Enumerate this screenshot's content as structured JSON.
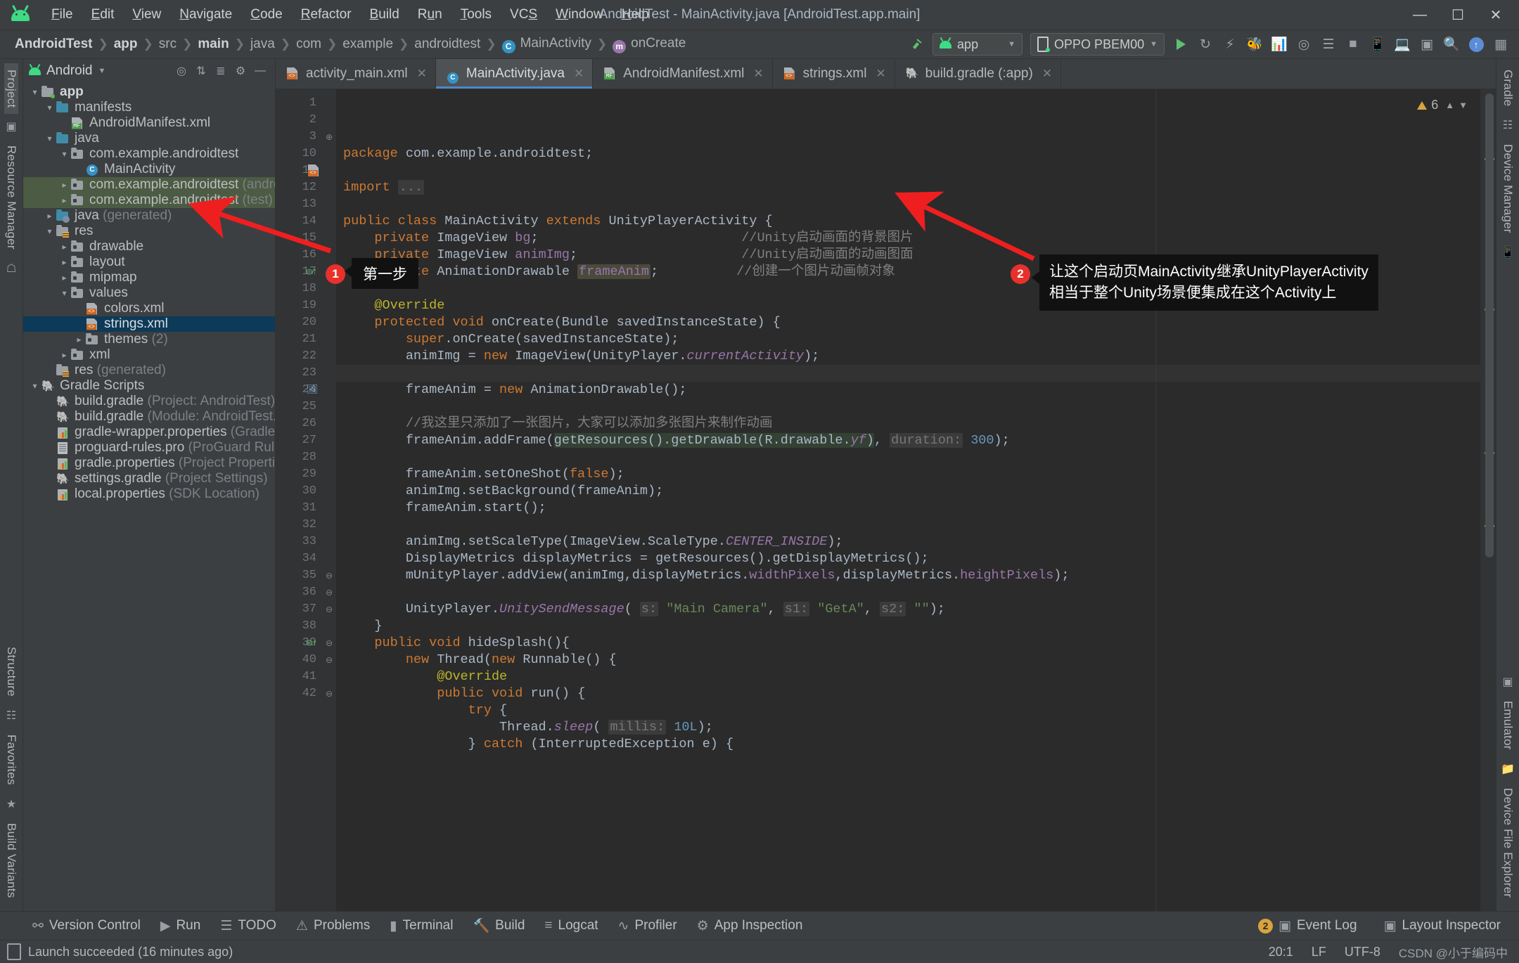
{
  "window": {
    "title": "AndroidTest - MainActivity.java [AndroidTest.app.main]",
    "minimize": "—",
    "maximize": "▢",
    "close": "✕"
  },
  "menu": [
    "File",
    "Edit",
    "View",
    "Navigate",
    "Code",
    "Refactor",
    "Build",
    "Run",
    "Tools",
    "VCS",
    "Window",
    "Help"
  ],
  "breadcrumb": [
    {
      "label": "AndroidTest",
      "bold": true
    },
    {
      "label": "app",
      "bold": true
    },
    {
      "label": "src",
      "bold": false
    },
    {
      "label": "main",
      "bold": true
    },
    {
      "label": "java",
      "bold": false
    },
    {
      "label": "com",
      "bold": false
    },
    {
      "label": "example",
      "bold": false
    },
    {
      "label": "androidtest",
      "bold": false
    },
    {
      "label": "MainActivity",
      "bold": false,
      "icon": "class-icon",
      "icon_letter": "C"
    },
    {
      "label": "onCreate",
      "bold": false,
      "icon": "method-icon",
      "icon_letter": "m"
    }
  ],
  "toolbar": {
    "module_selector": "app",
    "device_selector": "OPPO PBEM00",
    "run_label": "Run",
    "icons": [
      "build-icon",
      "run-icon",
      "rerun-icon",
      "debug-icon",
      "profile-icon",
      "attach-debugger-icon",
      "sdk-manager-icon",
      "avd-manager-icon",
      "stop-icon",
      "search-everywhere-icon",
      "project-structure-icon",
      "notifications-icon",
      "layout-inspector-icon",
      "device-file-explorer-icon"
    ]
  },
  "project_panel": {
    "title": "Android",
    "actions": [
      "locate-icon",
      "expand-all-icon",
      "collapse-all-icon",
      "settings-icon",
      "hide-icon"
    ],
    "tree": [
      {
        "depth": 0,
        "arrow": "v",
        "icon": "folder-module",
        "label": "app",
        "bold": true,
        "suffix": ""
      },
      {
        "depth": 1,
        "arrow": "v",
        "icon": "folder-blue",
        "label": "manifests",
        "suffix": ""
      },
      {
        "depth": 2,
        "arrow": "",
        "icon": "xml-manifest",
        "label": "AndroidManifest.xml",
        "suffix": ""
      },
      {
        "depth": 1,
        "arrow": "v",
        "icon": "folder-blue",
        "label": "java",
        "suffix": ""
      },
      {
        "depth": 2,
        "arrow": "v",
        "icon": "folder-package",
        "label": "com.example.androidtest",
        "suffix": ""
      },
      {
        "depth": 3,
        "arrow": "",
        "icon": "class-icon",
        "label": "MainActivity",
        "suffix": ""
      },
      {
        "depth": 2,
        "arrow": ">",
        "icon": "folder-package",
        "label": "com.example.androidtest",
        "suffix": " (androidTest)",
        "green": true
      },
      {
        "depth": 2,
        "arrow": ">",
        "icon": "folder-package",
        "label": "com.example.androidtest",
        "suffix": " (test)",
        "green": true
      },
      {
        "depth": 1,
        "arrow": ">",
        "icon": "folder-generated",
        "label": "java",
        "suffix": " (generated)"
      },
      {
        "depth": 1,
        "arrow": "v",
        "icon": "folder-res",
        "label": "res",
        "suffix": ""
      },
      {
        "depth": 2,
        "arrow": ">",
        "icon": "folder-package",
        "label": "drawable",
        "suffix": ""
      },
      {
        "depth": 2,
        "arrow": ">",
        "icon": "folder-package",
        "label": "layout",
        "suffix": ""
      },
      {
        "depth": 2,
        "arrow": ">",
        "icon": "folder-package",
        "label": "mipmap",
        "suffix": ""
      },
      {
        "depth": 2,
        "arrow": "v",
        "icon": "folder-package",
        "label": "values",
        "suffix": ""
      },
      {
        "depth": 3,
        "arrow": "",
        "icon": "xml-file",
        "label": "colors.xml",
        "suffix": ""
      },
      {
        "depth": 3,
        "arrow": "",
        "icon": "xml-file",
        "label": "strings.xml",
        "suffix": "",
        "selected": true
      },
      {
        "depth": 3,
        "arrow": ">",
        "icon": "folder-package",
        "label": "themes",
        "suffix": " (2)"
      },
      {
        "depth": 2,
        "arrow": ">",
        "icon": "folder-package",
        "label": "xml",
        "suffix": ""
      },
      {
        "depth": 1,
        "arrow": "",
        "icon": "folder-res",
        "label": "res",
        "suffix": " (generated)"
      },
      {
        "depth": 0,
        "arrow": "v",
        "icon": "gradle-icon",
        "label": "Gradle Scripts",
        "suffix": ""
      },
      {
        "depth": 1,
        "arrow": "",
        "icon": "gradle-icon",
        "label": "build.gradle",
        "suffix": " (Project: AndroidTest)"
      },
      {
        "depth": 1,
        "arrow": "",
        "icon": "gradle-icon",
        "label": "build.gradle",
        "suffix": " (Module: AndroidTest.app)"
      },
      {
        "depth": 1,
        "arrow": "",
        "icon": "properties-icon",
        "label": "gradle-wrapper.properties",
        "suffix": " (Gradle Version)"
      },
      {
        "depth": 1,
        "arrow": "",
        "icon": "doc-icon",
        "label": "proguard-rules.pro",
        "suffix": " (ProGuard Rules for Android"
      },
      {
        "depth": 1,
        "arrow": "",
        "icon": "properties-icon",
        "label": "gradle.properties",
        "suffix": " (Project Properties)"
      },
      {
        "depth": 1,
        "arrow": "",
        "icon": "gradle-icon",
        "label": "settings.gradle",
        "suffix": " (Project Settings)"
      },
      {
        "depth": 1,
        "arrow": "",
        "icon": "properties-icon",
        "label": "local.properties",
        "suffix": " (SDK Location)"
      }
    ]
  },
  "left_rail": [
    "Project",
    "Resource Manager",
    "Favorites",
    "Structure",
    "Build Variants"
  ],
  "right_rail": [
    "Gradle",
    "Device Manager",
    "Emulator",
    "Device File Explorer"
  ],
  "editor_tabs": [
    {
      "label": "activity_main.xml",
      "icon": "xml-file-icon",
      "active": false,
      "closable": true
    },
    {
      "label": "MainActivity.java",
      "icon": "class-icon",
      "active": true,
      "closable": true
    },
    {
      "label": "AndroidManifest.xml",
      "icon": "manifest-icon",
      "active": false,
      "closable": true
    },
    {
      "label": "strings.xml",
      "icon": "xml-file-icon",
      "active": false,
      "closable": true
    },
    {
      "label": "build.gradle (:app)",
      "icon": "gradle-icon",
      "active": false,
      "closable": true
    }
  ],
  "inspection": {
    "warning_count": "6"
  },
  "code": {
    "lines": [
      {
        "n": "1",
        "html": "<span class='kw'>package</span> com.example.androidtest;"
      },
      {
        "n": "2",
        "html": ""
      },
      {
        "n": "3",
        "html": "<span class='kw'>import</span> <span class='hint'>...</span>",
        "fold": "+"
      },
      {
        "n": "10",
        "html": ""
      },
      {
        "n": "11",
        "html": "<span class='kw'>public class</span> MainActivity <span class='kw'>extends</span> UnityPlayerActivity {",
        "gmark": "xml-file-icon"
      },
      {
        "n": "12",
        "html": "    <span class='kw'>private</span> ImageView <span class='fld'>bg</span>;                          <span class='cm'>//Unity启动画面的背景图片</span>"
      },
      {
        "n": "13",
        "html": "    <span class='kw'>private</span> ImageView <span class='fld'>animImg</span>;                     <span class='cm'>//Unity启动画面的动画图面</span>"
      },
      {
        "n": "14",
        "html": "    <span class='kw'>private</span> AnimationDrawable <span class='marker fld'>frameAnim</span>;          <span class='cm'>//创建一个图片动画帧对象</span>"
      },
      {
        "n": "15",
        "html": ""
      },
      {
        "n": "16",
        "html": "    <span class='anno'>@Override</span>"
      },
      {
        "n": "17",
        "html": "    <span class='kw'>protected void</span> onCreate(Bundle savedInstanceState) {",
        "gmark": "override-icon",
        "fold": "-"
      },
      {
        "n": "18",
        "html": "        <span class='kw'>super</span>.onCreate(savedInstanceState);"
      },
      {
        "n": "19",
        "html": "        animImg = <span class='kw'>new</span> ImageView(UnityPlayer.<span class='st'>currentActivity</span>);"
      },
      {
        "n": "20",
        "html": "",
        "current": true
      },
      {
        "n": "21",
        "html": "        frameAnim = <span class='kw'>new</span> AnimationDrawable();"
      },
      {
        "n": "22",
        "html": ""
      },
      {
        "n": "23",
        "html": "        <span class='cm'>//我这里只添加了一张图片，大家可以添加多张图片来制作动画</span>"
      },
      {
        "n": "24",
        "html": "        frameAnim.addFrame(<span class='fnhl'>getResources().getDrawable(R.drawable.<span class='st'>yf</span>)</span>, <span class='hint'>duration:</span> <span class='num'>300</span>);",
        "gmark": "image-icon"
      },
      {
        "n": "25",
        "html": ""
      },
      {
        "n": "26",
        "html": "        frameAnim.setOneShot(<span class='kw'>false</span>);"
      },
      {
        "n": "27",
        "html": "        animImg.setBackground(frameAnim);"
      },
      {
        "n": "28",
        "html": "        frameAnim.start();"
      },
      {
        "n": "29",
        "html": ""
      },
      {
        "n": "30",
        "html": "        animImg.setScaleType(ImageView.ScaleType.<span class='st'>CENTER_INSIDE</span>);"
      },
      {
        "n": "31",
        "html": "        DisplayMetrics displayMetrics = getResources().getDisplayMetrics();"
      },
      {
        "n": "32",
        "html": "        mUnityPlayer.addView(animImg,displayMetrics.<span class='fld'>widthPixels</span>,displayMetrics.<span class='fld'>heightPixels</span>);"
      },
      {
        "n": "33",
        "html": ""
      },
      {
        "n": "34",
        "html": "        UnityPlayer.<span class='st'>UnitySendMessage</span>( <span class='hint'>s:</span> <span class='str'>\"Main Camera\"</span>, <span class='hint'>s1:</span> <span class='str'>\"GetA\"</span>, <span class='hint'>s2:</span> <span class='str'>\"\"</span>);"
      },
      {
        "n": "35",
        "html": "    }",
        "fold": "-"
      },
      {
        "n": "36",
        "html": "    <span class='kw'>public void</span> hideSplash(){",
        "fold": "-"
      },
      {
        "n": "37",
        "html": "        <span class='kw'>new</span> Thread(<span class='kw'>new</span> Runnable() {",
        "fold": "-"
      },
      {
        "n": "38",
        "html": "            <span class='anno'>@Override</span>"
      },
      {
        "n": "39",
        "html": "            <span class='kw'>public void</span> run() {",
        "gmark": "override-icon",
        "fold": "-"
      },
      {
        "n": "40",
        "html": "                <span class='kw'>try</span> {",
        "fold": "-"
      },
      {
        "n": "41",
        "html": "                    Thread.<span class='st'>sleep</span>( <span class='hint'>millis:</span> <span class='num'>10L</span>);"
      },
      {
        "n": "42",
        "html": "                } <span class='kw'>catch</span> (InterruptedException e) {",
        "fold": "-"
      }
    ]
  },
  "annotations": {
    "step1_badge": "1",
    "step1_text": "第一步",
    "step2_badge": "2",
    "step2_text": "让这个启动页MainActivity继承UnityPlayerActivity\n相当于整个Unity场景便集成在这个Activity上"
  },
  "tool_windows": [
    {
      "label": "Version Control",
      "icon": "branch-icon"
    },
    {
      "label": "Run",
      "icon": "run-icon"
    },
    {
      "label": "TODO",
      "icon": "todo-icon"
    },
    {
      "label": "Problems",
      "icon": "problems-icon"
    },
    {
      "label": "Terminal",
      "icon": "terminal-icon"
    },
    {
      "label": "Build",
      "icon": "build-icon"
    },
    {
      "label": "Logcat",
      "icon": "logcat-icon"
    },
    {
      "label": "Profiler",
      "icon": "profiler-icon"
    },
    {
      "label": "App Inspection",
      "icon": "app-inspection-icon"
    }
  ],
  "tool_windows_right": [
    {
      "label": "Event Log",
      "icon": "event-log-icon",
      "count": "2"
    },
    {
      "label": "Layout Inspector",
      "icon": "layout-inspector-icon"
    }
  ],
  "status": {
    "message": "Launch succeeded (16 minutes ago)",
    "caret": "20:1",
    "line_ending": "LF",
    "encoding": "UTF-8",
    "watermark": "CSDN @小于编码中"
  }
}
